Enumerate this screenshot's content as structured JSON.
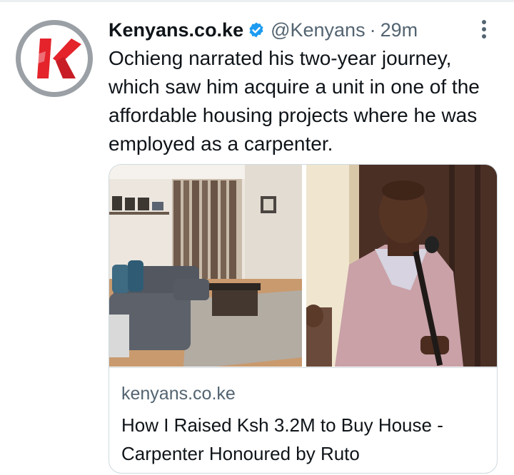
{
  "tweet": {
    "author_name": "Kenyans.co.ke",
    "verified_icon": "verified-badge-icon",
    "handle": "@Kenyans",
    "separator": "·",
    "time": "29m",
    "text": "Ochieng narrated his two-year journey, which saw him acquire a unit in one of the affordable housing projects where he was employed as a carpenter.",
    "avatar_icon": "kenyans-logo-icon",
    "more_icon": "more-options-icon"
  },
  "card": {
    "images": [
      "living-room-photo",
      "man-at-microphone-photo"
    ],
    "domain": "kenyans.co.ke",
    "title": "How I Raised Ksh 3.2M to Buy House - Carpenter Honoured by Ruto"
  },
  "colors": {
    "text": "#0f1419",
    "secondary": "#536471",
    "verified": "#1d9bf0",
    "brand_red": "#e4232b",
    "border": "#cfd9de"
  }
}
